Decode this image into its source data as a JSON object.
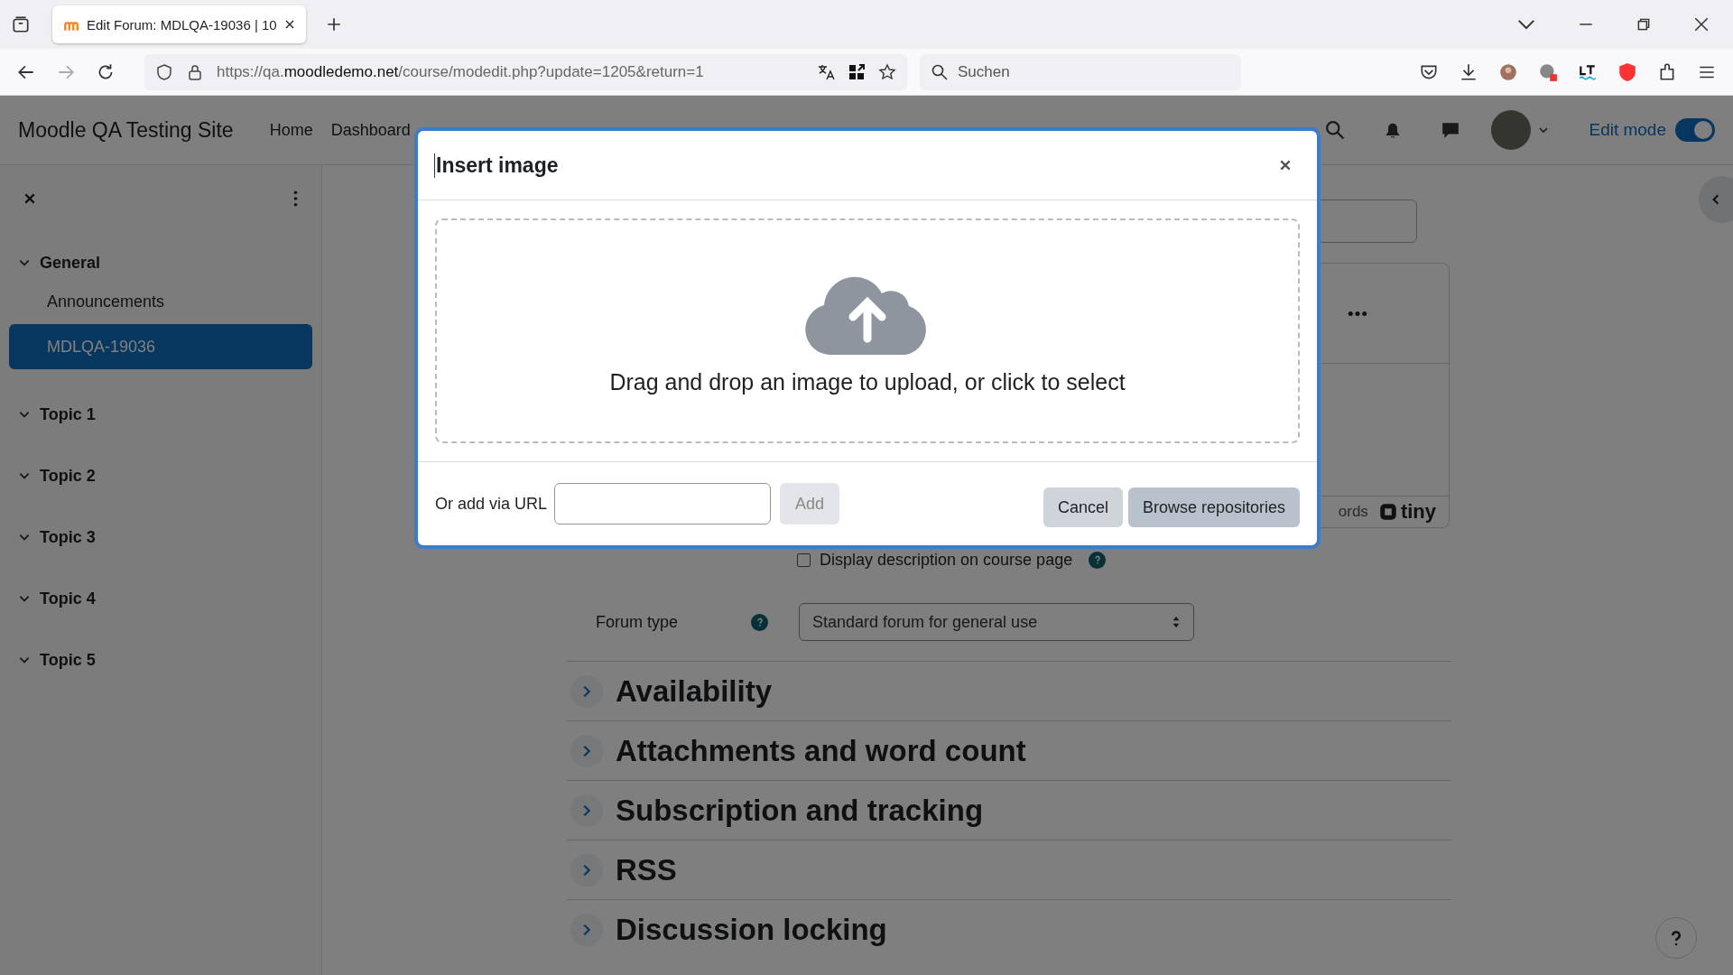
{
  "browser": {
    "tabs": [
      {
        "title": "Edit Forum: MDLQA-19036 | 10",
        "selected": true
      }
    ],
    "url": {
      "prefix": "https://qa.",
      "host": "moodledemo.net",
      "path": "/course/modedit.php?update=1205&return=1"
    },
    "search_placeholder": "Suchen"
  },
  "header": {
    "site_name": "Moodle QA Testing Site",
    "nav": [
      {
        "label": "Home"
      },
      {
        "label": "Dashboard"
      }
    ],
    "edit_mode": {
      "label": "Edit mode",
      "on": true
    }
  },
  "course_index": {
    "sections": [
      {
        "title": "General",
        "expanded": true,
        "children": [
          {
            "label": "Announcements",
            "selected": false
          },
          {
            "label": "MDLQA-19036",
            "selected": true
          }
        ]
      },
      {
        "title": "Topic 1",
        "expanded": true
      },
      {
        "title": "Topic 2",
        "expanded": true
      },
      {
        "title": "Topic 3",
        "expanded": true
      },
      {
        "title": "Topic 4",
        "expanded": true
      },
      {
        "title": "Topic 5",
        "expanded": true
      }
    ]
  },
  "form": {
    "editor_footer": {
      "word_count": "ords",
      "logo": "tiny"
    },
    "display_description": {
      "label": "Display description on course page",
      "checked": false
    },
    "forum_type": {
      "label": "Forum type",
      "value": "Standard forum for general use"
    },
    "sections": [
      {
        "title": "Availability",
        "expanded": false
      },
      {
        "title": "Attachments and word count",
        "expanded": false
      },
      {
        "title": "Subscription and tracking",
        "expanded": false
      },
      {
        "title": "RSS",
        "expanded": false
      },
      {
        "title": "Discussion locking",
        "expanded": false
      }
    ]
  },
  "modal": {
    "title": "Insert image",
    "dropzone_text": "Drag and drop an image to upload, or click to select",
    "url_label": "Or add via URL",
    "add_button": {
      "label": "Add",
      "disabled": true
    },
    "buttons": [
      {
        "label": "Cancel",
        "kind": "secondary"
      },
      {
        "label": "Browse repositories",
        "kind": "primary"
      }
    ]
  }
}
